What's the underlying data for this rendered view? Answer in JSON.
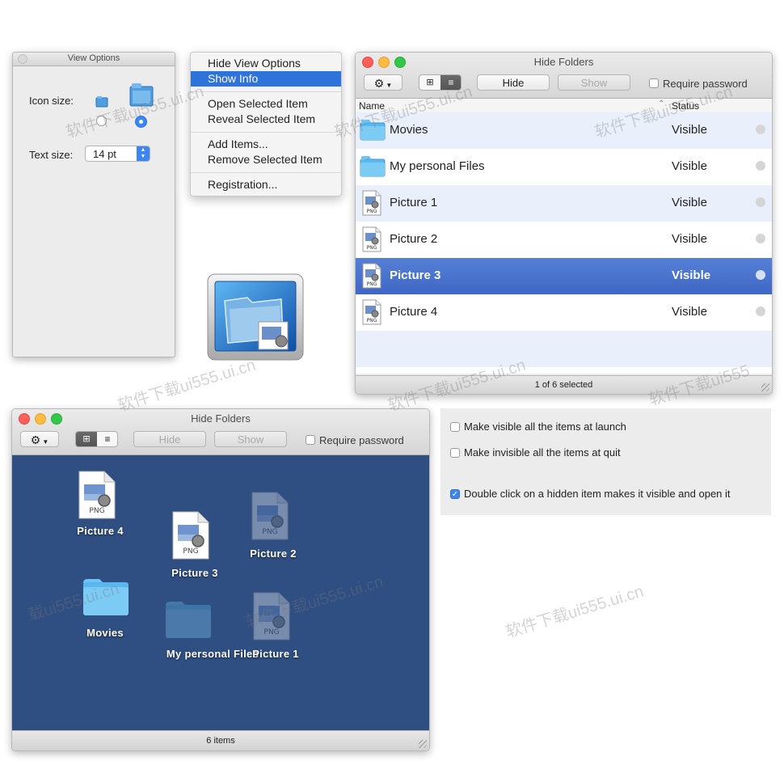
{
  "view_options": {
    "title": "View Options",
    "icon_size_label": "Icon size:",
    "text_size_label": "Text size:",
    "text_size_value": "14 pt"
  },
  "context_menu": {
    "items": [
      "Hide View Options",
      "Show Info",
      "Open Selected Item",
      "Reveal Selected Item",
      "Add Items...",
      "Remove Selected Item",
      "Registration..."
    ],
    "selected_index": 1
  },
  "list_window": {
    "title": "Hide Folders",
    "hide_label": "Hide",
    "show_label": "Show",
    "require_password": "Require password",
    "columns": [
      "Name",
      "Status"
    ],
    "rows": [
      {
        "name": "Movies",
        "status": "Visible",
        "kind": "folder"
      },
      {
        "name": "My personal Files",
        "status": "Visible",
        "kind": "folder"
      },
      {
        "name": "Picture 1",
        "status": "Visible",
        "kind": "png"
      },
      {
        "name": "Picture 2",
        "status": "Visible",
        "kind": "png"
      },
      {
        "name": "Picture 3",
        "status": "Visible",
        "kind": "png"
      },
      {
        "name": "Picture 4",
        "status": "Visible",
        "kind": "png"
      }
    ],
    "selected_row": 4,
    "status_bar": "1 of 6 selected",
    "png_label": "PNG"
  },
  "icon_window": {
    "title": "Hide Folders",
    "hide_label": "Hide",
    "show_label": "Show",
    "require_password": "Require password",
    "items": [
      "Picture 4",
      "Picture 3",
      "Picture 2",
      "Movies",
      "My personal Files",
      "Picture 1"
    ],
    "status_bar": "6 items",
    "png_label": "PNG"
  },
  "preferences": {
    "options": [
      {
        "label": "Make visible all the items at launch",
        "checked": false
      },
      {
        "label": "Make invisible all the items at quit",
        "checked": false
      },
      {
        "label": "Double click on a hidden item makes it visible and open it",
        "checked": true
      }
    ]
  },
  "watermarks": [
    "软件下载ui555.ui.cn",
    "软件下载ui555.ui.cn",
    "软件下载ui555.ui.cn",
    "软件下载ui555.ui.cn",
    "软件下载ui555.ui.cn",
    "软件下载ui555.ui.cn",
    "软件下载ui555",
    "载ui555.ui.cn",
    "软件下载ui555.ui.cn",
    "软件下载ui555.ui.cn"
  ],
  "colors": {
    "selection": "#2e73d9",
    "row_selection": "#4a72cf",
    "icon_bg": "#2f4e82",
    "folder": "#5ab8ef"
  }
}
